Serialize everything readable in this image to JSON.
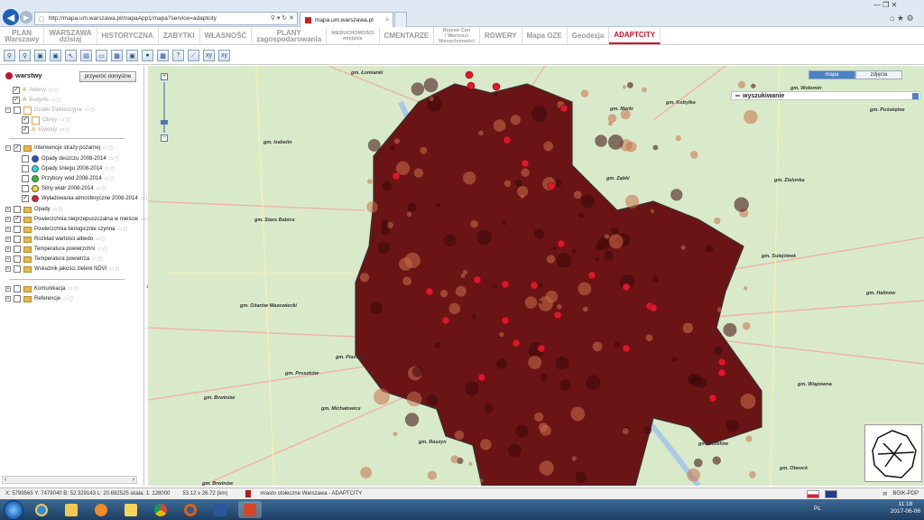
{
  "browser": {
    "url": "http://mapa.um.warszawa.pl/mapaApp1/mapa?service=adaptcity",
    "url_icons": "⚲ ▾ ↻ ✕",
    "tab_title": "mapa.um.warszawa.pl",
    "tab_close": "×",
    "window_controls": "—   ❐   ✕",
    "toolbar_icons": "⌂ ★ ⚙"
  },
  "menu": {
    "items": [
      {
        "label": "PLAN\nWarszawy",
        "small": false
      },
      {
        "label": "WARSZAWA\ndzisiaj",
        "small": false
      },
      {
        "label": "HISTORYCZNA",
        "small": false
      },
      {
        "label": "ZABYTKI",
        "small": false
      },
      {
        "label": "WŁASNOŚĆ",
        "small": false
      },
      {
        "label": "PLANY\nzagospodarowania",
        "small": false
      },
      {
        "label": "NIERUCHOMOŚCI\nmiejskie",
        "small": true
      },
      {
        "label": "CMENTARZE",
        "small": false
      },
      {
        "label": "Rejestr Cen\ni Wartości\nNieruchomości",
        "small": true
      },
      {
        "label": "ROWERY",
        "small": false
      },
      {
        "label": "Mapa OZE",
        "small": false
      },
      {
        "label": "Geodezja",
        "small": false
      },
      {
        "label": "ADAPTCITY",
        "small": false,
        "active": true
      }
    ]
  },
  "toolbar": {
    "tools": [
      "⚲",
      "⚲",
      "▣",
      "▣",
      "↖",
      "▤",
      "▭",
      "▦",
      "▣",
      "●",
      "▩",
      "?",
      "⟋",
      "xy",
      "xy"
    ]
  },
  "layers": {
    "title": "warstwy",
    "reset_label": "przywróć domyślne",
    "items": [
      {
        "label": "Adresy",
        "dim": true
      },
      {
        "label": "Budynki",
        "dim": true
      },
      {
        "label": "Działki Ewidencyjne",
        "dim": true
      },
      {
        "label": "Obręy",
        "dim": true
      },
      {
        "label": "Etykiety",
        "dim": true
      },
      {
        "label": "Interwencje straży pożarnej",
        "dim": false
      },
      {
        "label": "Opady deszczu 2008-2014",
        "color": "#1f4fd6"
      },
      {
        "label": "Opady śniegu 2008-2014",
        "color": "#28d7e0"
      },
      {
        "label": "Przybory wód 2008-2014",
        "color": "#2bbf3c"
      },
      {
        "label": "Silny wiatr 2008-2014",
        "color": "#f2e024"
      },
      {
        "label": "Wyładowania atmosferyczne 2008-2014",
        "color": "#e01b2c"
      },
      {
        "label": "Opady"
      },
      {
        "label": "Powierzchnia nieprzepuszczalna w mieście"
      },
      {
        "label": "Powierzchnia biologicznie czynna"
      },
      {
        "label": "Rozkład wartości albedo"
      },
      {
        "label": "Temperatura powierzchni"
      },
      {
        "label": "Temperatura powietrza"
      },
      {
        "label": "Wskaźnik jakości zieleni NDVI"
      },
      {
        "label": "Komunikacja"
      },
      {
        "label": "Referencje"
      }
    ],
    "scroll_left": "‹",
    "scroll_right": "›",
    "collapse_icon": "«"
  },
  "map": {
    "tabs": [
      "mapa",
      "zdjęcia"
    ],
    "search_label": "wyszukiwanie",
    "zoom_in": "+",
    "zoom_out": "−",
    "labels": [
      "gm. Łomianki",
      "gm. Wołomin",
      "gm. Kobyłka",
      "gm. Marki",
      "gm. Poświętne",
      "gm. Izabelin",
      "gm. Ząbki",
      "gm. Zielonka",
      "gm. Stare Babice",
      "gm. Sulejówek",
      "gm. Halinów",
      "gm. Ożarów Mazowiecki",
      "gm. Piastów",
      "gm. Pruszków",
      "gm. Brwinów",
      "gm. Michałowice",
      "gm. Wiązowna",
      "gm. Raszyn",
      "gm. Józefów",
      "gm. Otwock",
      "gm. Brwinów"
    ],
    "colors": {
      "background": "#d9eacb",
      "urban": "#5a1012",
      "marker": "#e0162b",
      "accent": "#4c82c3"
    }
  },
  "status": {
    "coords": "X: 5799565 Y: 7479040  B: 52.329143 L: 20.692525  skala: 1: 128000",
    "extent": "53.12 x 26.72 (km)",
    "source": "miasto stołeczne Warszawa - ADAPTCITY",
    "credit": "BGIK-PDP"
  },
  "taskbar": {
    "lang": "PL",
    "time": "11:18",
    "date": "2017-06-06"
  }
}
